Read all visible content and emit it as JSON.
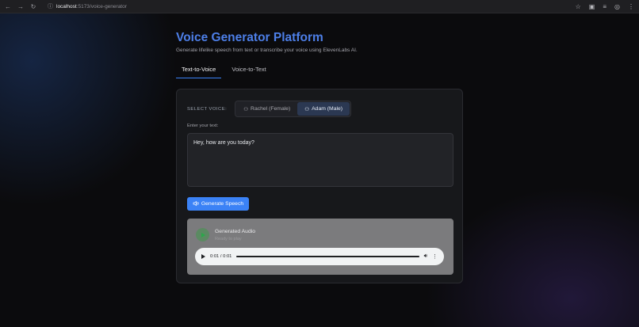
{
  "browser": {
    "url_host": "localhost",
    "url_path": ":5173/voice-generator",
    "back_icon": "←",
    "forward_icon": "→",
    "reload_icon": "↻"
  },
  "header": {
    "title": "Voice Generator Platform",
    "subtitle": "Generate lifelike speech from text or transcribe your voice using ElevenLabs AI."
  },
  "tabs": [
    {
      "label": "Text-to-Voice",
      "active": true
    },
    {
      "label": "Voice-to-Text",
      "active": false
    }
  ],
  "voice_select": {
    "label": "SELECT VOICE:",
    "options": [
      {
        "label": "Rachel (Female)",
        "selected": false
      },
      {
        "label": "Adam (Male)",
        "selected": true
      }
    ]
  },
  "text_input": {
    "label": "Enter your text:",
    "value": "Hey, how are you today?"
  },
  "generate_button": {
    "label": "Generate Speech"
  },
  "audio": {
    "title": "Generated Audio",
    "subtitle": "Ready to play",
    "time": "0:01 / 0:01",
    "progress": 1.0
  },
  "colors": {
    "accent": "#3b82f6",
    "title": "#4d7fe8"
  }
}
